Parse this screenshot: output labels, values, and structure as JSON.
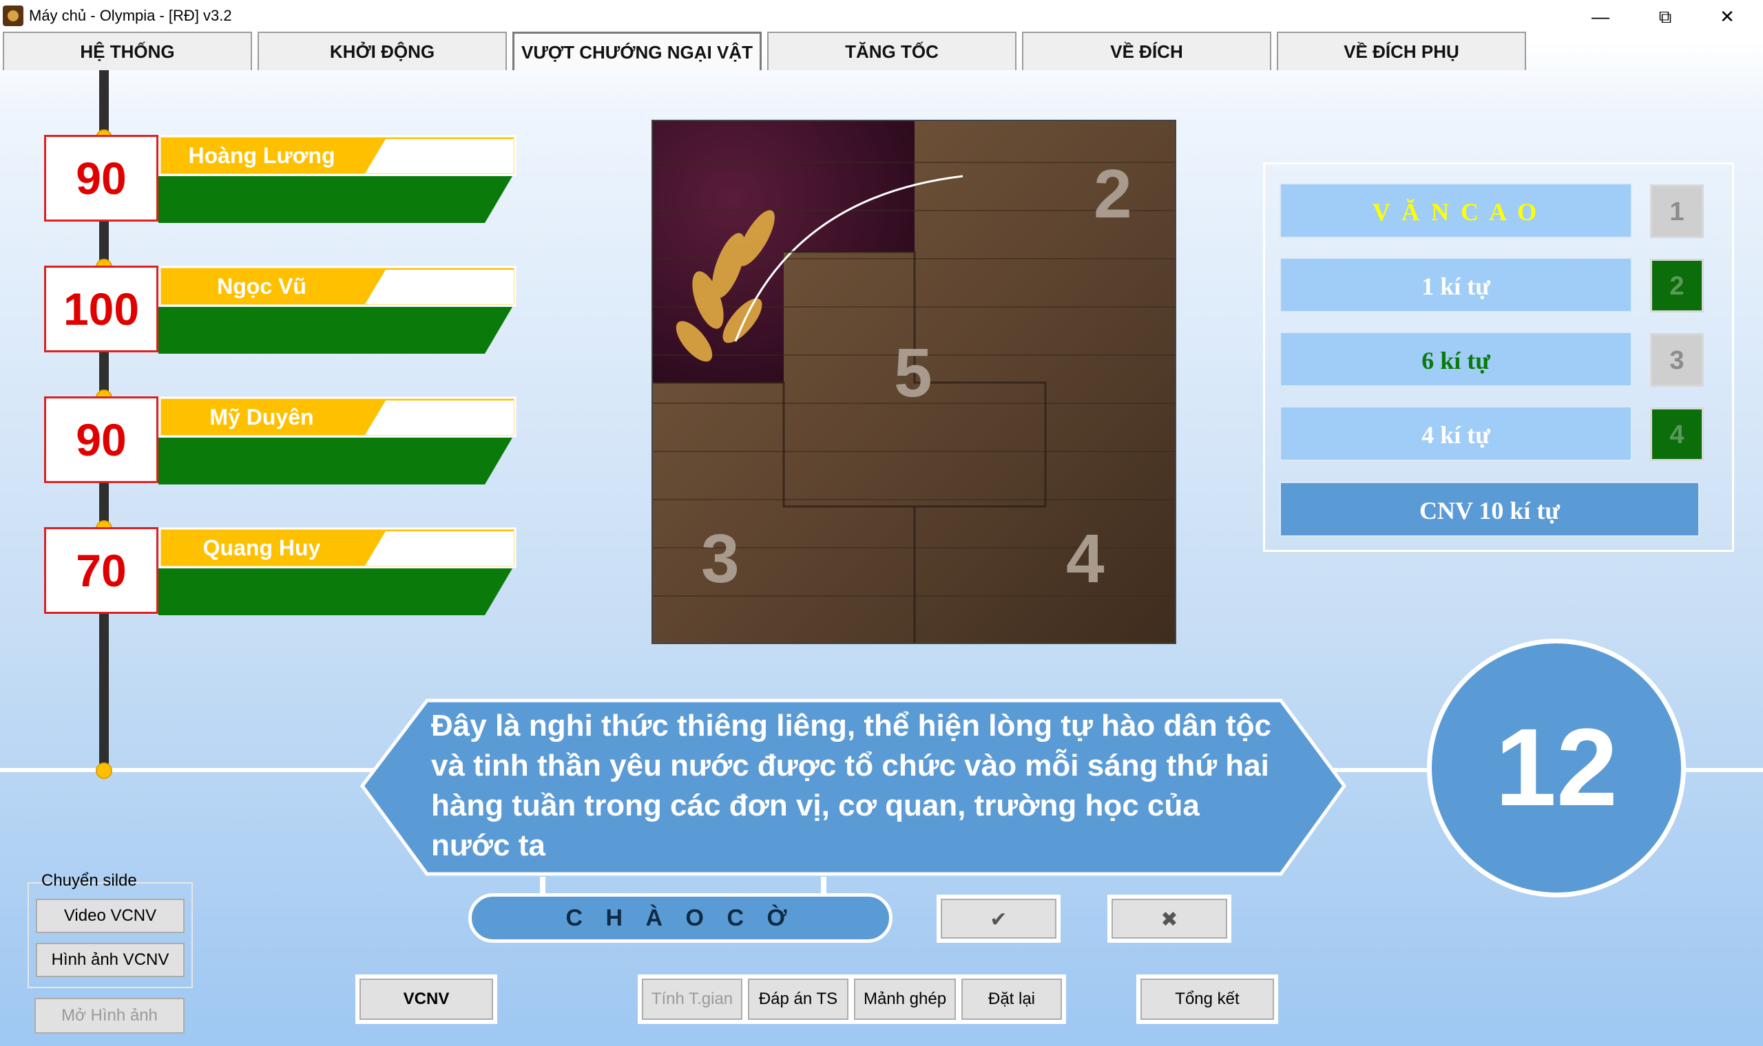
{
  "window": {
    "title": "Máy chủ - Olympia - [RĐ] v3.2",
    "controls": {
      "minimize": "—",
      "maximize": "⧉",
      "close": "✕"
    }
  },
  "tabs": [
    {
      "label": "HỆ THỐNG",
      "active": false
    },
    {
      "label": "KHỞI ĐỘNG",
      "active": false
    },
    {
      "label": "VƯỢT CHƯỚNG NGẠI VẬT",
      "active": true
    },
    {
      "label": "TĂNG TỐC",
      "active": false
    },
    {
      "label": "VỀ ĐÍCH",
      "active": false
    },
    {
      "label": "VỀ ĐÍCH PHỤ",
      "active": false
    }
  ],
  "players": [
    {
      "name": "Hoàng Lương",
      "score": "90"
    },
    {
      "name": "Ngọc Vũ",
      "score": "100"
    },
    {
      "name": "Mỹ Duyên",
      "score": "90"
    },
    {
      "name": "Quang Huy",
      "score": "70"
    }
  ],
  "puzzle": {
    "pieces": [
      "2",
      "5",
      "3",
      "4"
    ]
  },
  "rows": [
    {
      "text": "V Ă N C A O",
      "number": "1",
      "state": "gray",
      "color": "#ffff00"
    },
    {
      "text": "1 kí tự",
      "number": "2",
      "state": "green",
      "color": "#ffffff"
    },
    {
      "text": "6 kí tự",
      "number": "3",
      "state": "gray",
      "color": "#0a7a0a"
    },
    {
      "text": "4 kí tự",
      "number": "4",
      "state": "green",
      "color": "#ffffff"
    }
  ],
  "cnv": "CNV 10 kí tự",
  "question": "Đây là nghi thức thiêng liêng, thể hiện lòng tự hào dân tộc và tinh thần yêu nước được tổ chức vào mỗi sáng thứ hai hàng tuần trong các đơn vị, cơ quan, trường học của nước ta",
  "timer": "12",
  "answer": "C H À O C Ờ",
  "controls": {
    "correct_icon": "✔",
    "wrong_icon": "✖",
    "group_label": "Chuyển silde",
    "video_vcnv": "Video VCNV",
    "image_vcnv": "Hình ảnh VCNV",
    "open_image": "Mở Hình ảnh",
    "vcnv": "VCNV",
    "time": "Tính T.gian",
    "ts_answer": "Đáp án TS",
    "pieces": "Mảnh ghép",
    "reset": "Đặt lại",
    "summary": "Tổng kết"
  },
  "colors": {
    "accent": "#5b9bd5",
    "name_bar": "#ffc000",
    "score_bar": "#0a7a0a",
    "score_text": "#e00000"
  }
}
